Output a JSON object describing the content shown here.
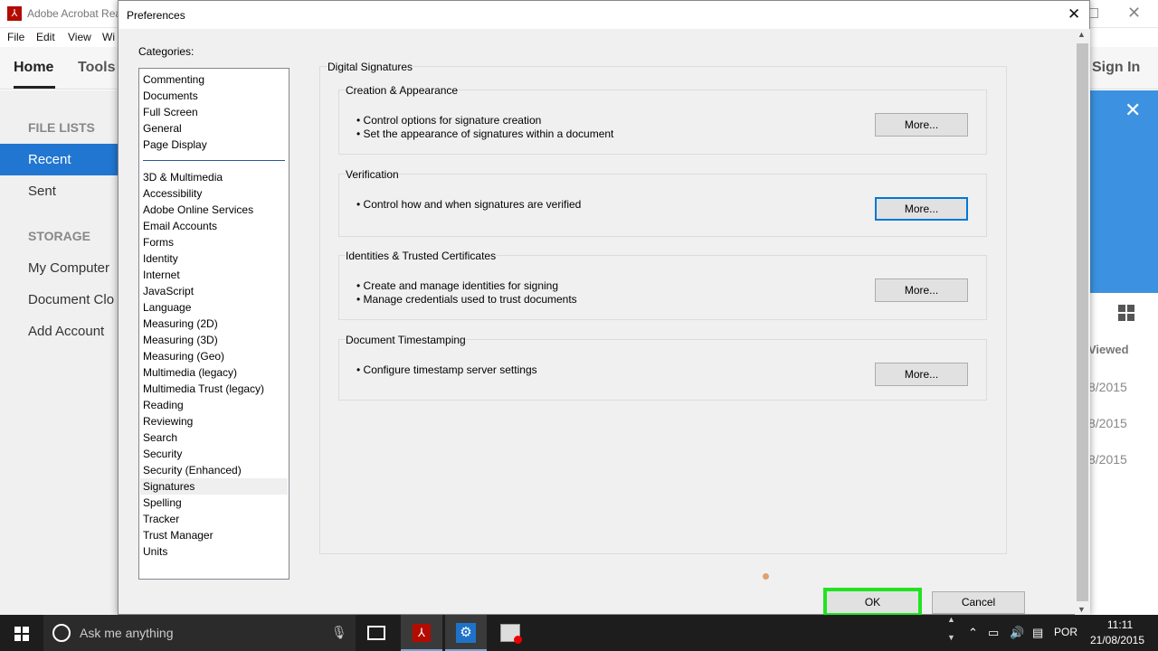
{
  "background_app": {
    "title": "Adobe Acrobat Rea",
    "menu": [
      "File",
      "Edit",
      "View",
      "Wi"
    ],
    "tabs": [
      "Home",
      "Tools"
    ],
    "sign_in": "Sign In",
    "left_nav": {
      "file_lists_heading": "FILE LISTS",
      "recent": "Recent",
      "sent": "Sent",
      "storage_heading": "STORAGE",
      "my_computer": "My Computer",
      "document_cloud": "Document Clo",
      "add_account": "Add Account"
    },
    "right_column": {
      "viewed_header": "Viewed",
      "dates": [
        "8/2015",
        "8/2015",
        "8/2015"
      ]
    }
  },
  "dialog": {
    "title": "Preferences",
    "categories_label": "Categories:",
    "top_categories": [
      "Commenting",
      "Documents",
      "Full Screen",
      "General",
      "Page Display"
    ],
    "categories": [
      "3D & Multimedia",
      "Accessibility",
      "Adobe Online Services",
      "Email Accounts",
      "Forms",
      "Identity",
      "Internet",
      "JavaScript",
      "Language",
      "Measuring (2D)",
      "Measuring (3D)",
      "Measuring (Geo)",
      "Multimedia (legacy)",
      "Multimedia Trust (legacy)",
      "Reading",
      "Reviewing",
      "Search",
      "Security",
      "Security (Enhanced)",
      "Signatures",
      "Spelling",
      "Tracker",
      "Trust Manager",
      "Units"
    ],
    "selected_category": "Signatures",
    "panel_title": "Digital Signatures",
    "groups": [
      {
        "title": "Creation & Appearance",
        "bullets": [
          "• Control options for signature creation",
          "• Set the appearance of signatures within a document"
        ],
        "button": "More..."
      },
      {
        "title": "Verification",
        "bullets": [
          "• Control how and when signatures are verified"
        ],
        "button": "More..."
      },
      {
        "title": "Identities & Trusted Certificates",
        "bullets": [
          "• Create and manage identities for signing",
          "• Manage credentials used to trust documents"
        ],
        "button": "More..."
      },
      {
        "title": "Document Timestamping",
        "bullets": [
          "• Configure timestamp server settings"
        ],
        "button": "More..."
      }
    ],
    "ok_label": "OK",
    "cancel_label": "Cancel"
  },
  "taskbar": {
    "search_placeholder": "Ask me anything",
    "language": "POR",
    "time": "11:11",
    "date": "21/08/2015"
  },
  "colors": {
    "accent_blue": "#2176d2",
    "highlight_green": "#22e322",
    "focus_blue": "#0078d7"
  }
}
